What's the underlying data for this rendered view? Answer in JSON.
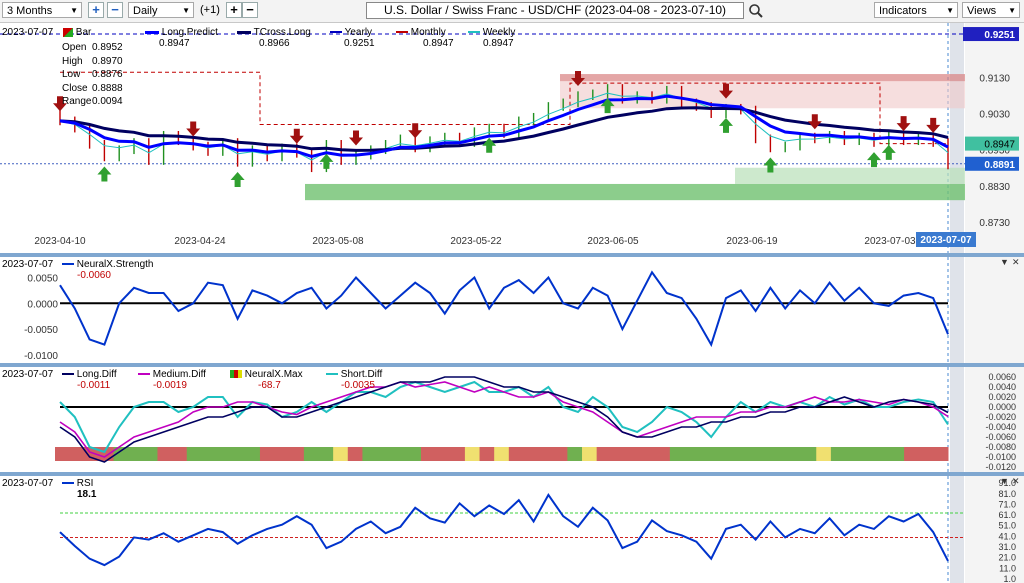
{
  "toolbar": {
    "period": "3 Months",
    "interval": "Daily",
    "offset": "(+1)",
    "title": "U.S. Dollar / Swiss Franc - USD/CHF (2023-04-08 - 2023-07-10)",
    "indicators": "Indicators",
    "views": "Views"
  },
  "main": {
    "date": "2023-07-07",
    "bar_label": "Bar",
    "ohlc": [
      {
        "k": "Open",
        "v": "0.8952"
      },
      {
        "k": "High",
        "v": "0.8970"
      },
      {
        "k": "Low",
        "v": "0.8876"
      },
      {
        "k": "Close",
        "v": "0.8888"
      },
      {
        "k": "Range",
        "v": "0.0094"
      }
    ],
    "legend": [
      {
        "name": "Long.Predict",
        "value": "0.8947",
        "color": "#0000ff"
      },
      {
        "name": "TCross.Long",
        "value": "0.8966",
        "color": "#000060"
      },
      {
        "name": "Yearly",
        "value": "0.9251",
        "color": "#0000c0"
      },
      {
        "name": "Monthly",
        "value": "0.8947",
        "color": "#c00000"
      },
      {
        "name": "Weekly",
        "value": "0.8947",
        "color": "#20c0c0"
      }
    ],
    "yaxis": [
      "0.9130",
      "0.9030",
      "0.8930",
      "0.8830",
      "0.8730"
    ],
    "xaxis": [
      "2023-04-10",
      "2023-04-24",
      "2023-05-08",
      "2023-05-22",
      "2023-06-05",
      "2023-06-19",
      "2023-07-03"
    ],
    "badges": {
      "yearly": "0.9251",
      "predict": "0.8947",
      "close": "0.8891",
      "cursor_date": "2023-07-07"
    }
  },
  "strength": {
    "date": "2023-07-07",
    "name": "NeuralX.Strength",
    "value": "-0.0060",
    "yaxis": [
      "0.0050",
      "0.0000",
      "-0.0050",
      "-0.0100"
    ]
  },
  "diff": {
    "date": "2023-07-07",
    "legend": [
      {
        "name": "Long.Diff",
        "value": "-0.0011",
        "color": "#000060"
      },
      {
        "name": "Medium.Diff",
        "value": "-0.0019",
        "color": "#c000c0"
      },
      {
        "name": "NeuralX.Max",
        "value": "-68.7",
        "color": "#c00000"
      },
      {
        "name": "Short.Diff",
        "value": "-0.0035",
        "color": "#20c0c0"
      }
    ],
    "yaxis": [
      "0.0060",
      "0.0040",
      "0.0020",
      "0.0000",
      "-0.0020",
      "-0.0040",
      "-0.0060",
      "-0.0080",
      "-0.0100",
      "-0.0120"
    ]
  },
  "rsi": {
    "date": "2023-07-07",
    "name": "RSI",
    "value": "18.1",
    "yaxis": [
      "91.0",
      "81.0",
      "71.0",
      "61.0",
      "51.0",
      "41.0",
      "31.0",
      "21.0",
      "11.0",
      "1.0"
    ]
  },
  "series": {
    "close": [
      0.901,
      0.899,
      0.8945,
      0.891,
      0.893,
      0.895,
      0.89,
      0.897,
      0.8955,
      0.894,
      0.8925,
      0.895,
      0.8895,
      0.893,
      0.891,
      0.8935,
      0.892,
      0.888,
      0.8945,
      0.89,
      0.8915,
      0.893,
      0.8945,
      0.896,
      0.8935,
      0.8955,
      0.8965,
      0.895,
      0.898,
      0.899,
      0.8975,
      0.901,
      0.902,
      0.905,
      0.906,
      0.908,
      0.9085,
      0.91,
      0.907,
      0.908,
      0.907,
      0.9095,
      0.906,
      0.905,
      0.903,
      0.9045,
      0.904,
      0.896,
      0.8935,
      0.894,
      0.8965,
      0.896,
      0.897,
      0.8955,
      0.8965,
      0.895,
      0.897,
      0.8955,
      0.8965,
      0.895,
      0.8888
    ],
    "strength": [
      0.0035,
      -0.001,
      -0.007,
      -0.008,
      0.0,
      0.003,
      0.002,
      0.002,
      -0.0015,
      0.0,
      0.004,
      0.0035,
      -0.003,
      0.0025,
      0.0015,
      0.0,
      0.002,
      0.003,
      -0.001,
      0.0015,
      0.005,
      0.002,
      -0.001,
      0.0015,
      0.004,
      0.002,
      -0.002,
      0.0025,
      0.005,
      -0.001,
      0.003,
      0.0045,
      0.002,
      0.005,
      0.0,
      -0.001,
      0.003,
      0.0015,
      -0.005,
      0.0005,
      0.006,
      0.002,
      0.001,
      -0.003,
      -0.008,
      0.001,
      0.0025,
      -0.0015,
      0.003,
      -0.001,
      0.0025,
      0.0,
      0.004,
      0.0005,
      0.003,
      0.0,
      -0.0005,
      0.0015,
      0.002,
      0.001,
      -0.006
    ],
    "long_diff": [
      -0.004,
      -0.006,
      -0.01,
      -0.011,
      -0.009,
      -0.007,
      -0.006,
      -0.005,
      -0.004,
      -0.003,
      -0.002,
      -0.002,
      -0.001,
      0.0,
      0.0,
      -0.002,
      -0.002,
      -0.001,
      0.0,
      0.001,
      0.002,
      0.003,
      0.004,
      0.005,
      0.005,
      0.005,
      0.006,
      0.006,
      0.006,
      0.005,
      0.004,
      0.004,
      0.003,
      0.003,
      0.002,
      0.001,
      0.0,
      -0.002,
      -0.005,
      -0.006,
      -0.006,
      -0.005,
      -0.004,
      -0.004,
      -0.003,
      -0.003,
      -0.002,
      -0.002,
      -0.001,
      -0.001,
      0.0,
      0.0,
      0.001,
      0.002,
      0.001,
      0.0,
      0.001,
      0.0015,
      0.001,
      0.0005,
      -0.0011
    ],
    "medium_diff": [
      -0.003,
      -0.005,
      -0.009,
      -0.01,
      -0.008,
      -0.006,
      -0.005,
      -0.004,
      -0.003,
      -0.001,
      0.0,
      0.0,
      0.001,
      0.001,
      0.0,
      -0.001,
      -0.0015,
      0.0,
      0.001,
      0.002,
      0.003,
      0.004,
      0.004,
      0.005,
      0.004,
      0.0045,
      0.005,
      0.004,
      0.003,
      0.004,
      0.003,
      0.002,
      0.002,
      0.003,
      0.001,
      0.0,
      -0.001,
      -0.003,
      -0.005,
      -0.006,
      -0.005,
      -0.004,
      -0.003,
      -0.002,
      -0.002,
      -0.002,
      -0.001,
      -0.001,
      0.0,
      0.0,
      0.001,
      0.002,
      0.001,
      0.001,
      0.0015,
      0.001,
      0.0005,
      0.0015,
      0.001,
      0.0,
      -0.0019
    ],
    "short_diff": [
      0.001,
      -0.002,
      -0.008,
      -0.009,
      -0.004,
      0.0,
      0.001,
      0.001,
      -0.001,
      0.0,
      0.002,
      0.002,
      -0.002,
      0.001,
      0.0005,
      -0.002,
      -0.001,
      0.001,
      -0.001,
      0.001,
      0.003,
      0.003,
      0.002,
      0.004,
      0.005,
      0.004,
      0.003,
      0.004,
      0.005,
      0.003,
      0.003,
      0.004,
      0.002,
      0.004,
      0.0,
      -0.001,
      0.002,
      0.0,
      -0.004,
      -0.005,
      -0.003,
      0.0,
      -0.001,
      -0.003,
      -0.006,
      -0.002,
      0.001,
      -0.001,
      0.001,
      0.0,
      0.001,
      0.0,
      0.002,
      0.0005,
      0.0015,
      0.0,
      0.0,
      0.001,
      0.0015,
      0.001,
      -0.0035
    ],
    "rsi": [
      45,
      32,
      20,
      14,
      22,
      40,
      38,
      44,
      36,
      42,
      48,
      45,
      34,
      42,
      48,
      52,
      60,
      52,
      30,
      36,
      48,
      55,
      44,
      50,
      68,
      58,
      54,
      72,
      60,
      70,
      62,
      75,
      55,
      80,
      60,
      50,
      68,
      56,
      30,
      36,
      56,
      46,
      42,
      36,
      20,
      48,
      52,
      38,
      55,
      40,
      48,
      44,
      58,
      42,
      52,
      48,
      60,
      55,
      62,
      45,
      18
    ],
    "strip": [
      "r",
      "r",
      "r",
      "r",
      "g",
      "g",
      "g",
      "r",
      "r",
      "g",
      "g",
      "g",
      "g",
      "g",
      "r",
      "r",
      "r",
      "g",
      "g",
      "y",
      "r",
      "g",
      "g",
      "g",
      "g",
      "r",
      "r",
      "r",
      "y",
      "r",
      "y",
      "r",
      "r",
      "r",
      "r",
      "g",
      "y",
      "r",
      "r",
      "r",
      "r",
      "r",
      "g",
      "g",
      "g",
      "g",
      "g",
      "g",
      "g",
      "g",
      "g",
      "g",
      "y",
      "g",
      "g",
      "g",
      "g",
      "g",
      "r",
      "r",
      "r"
    ]
  }
}
